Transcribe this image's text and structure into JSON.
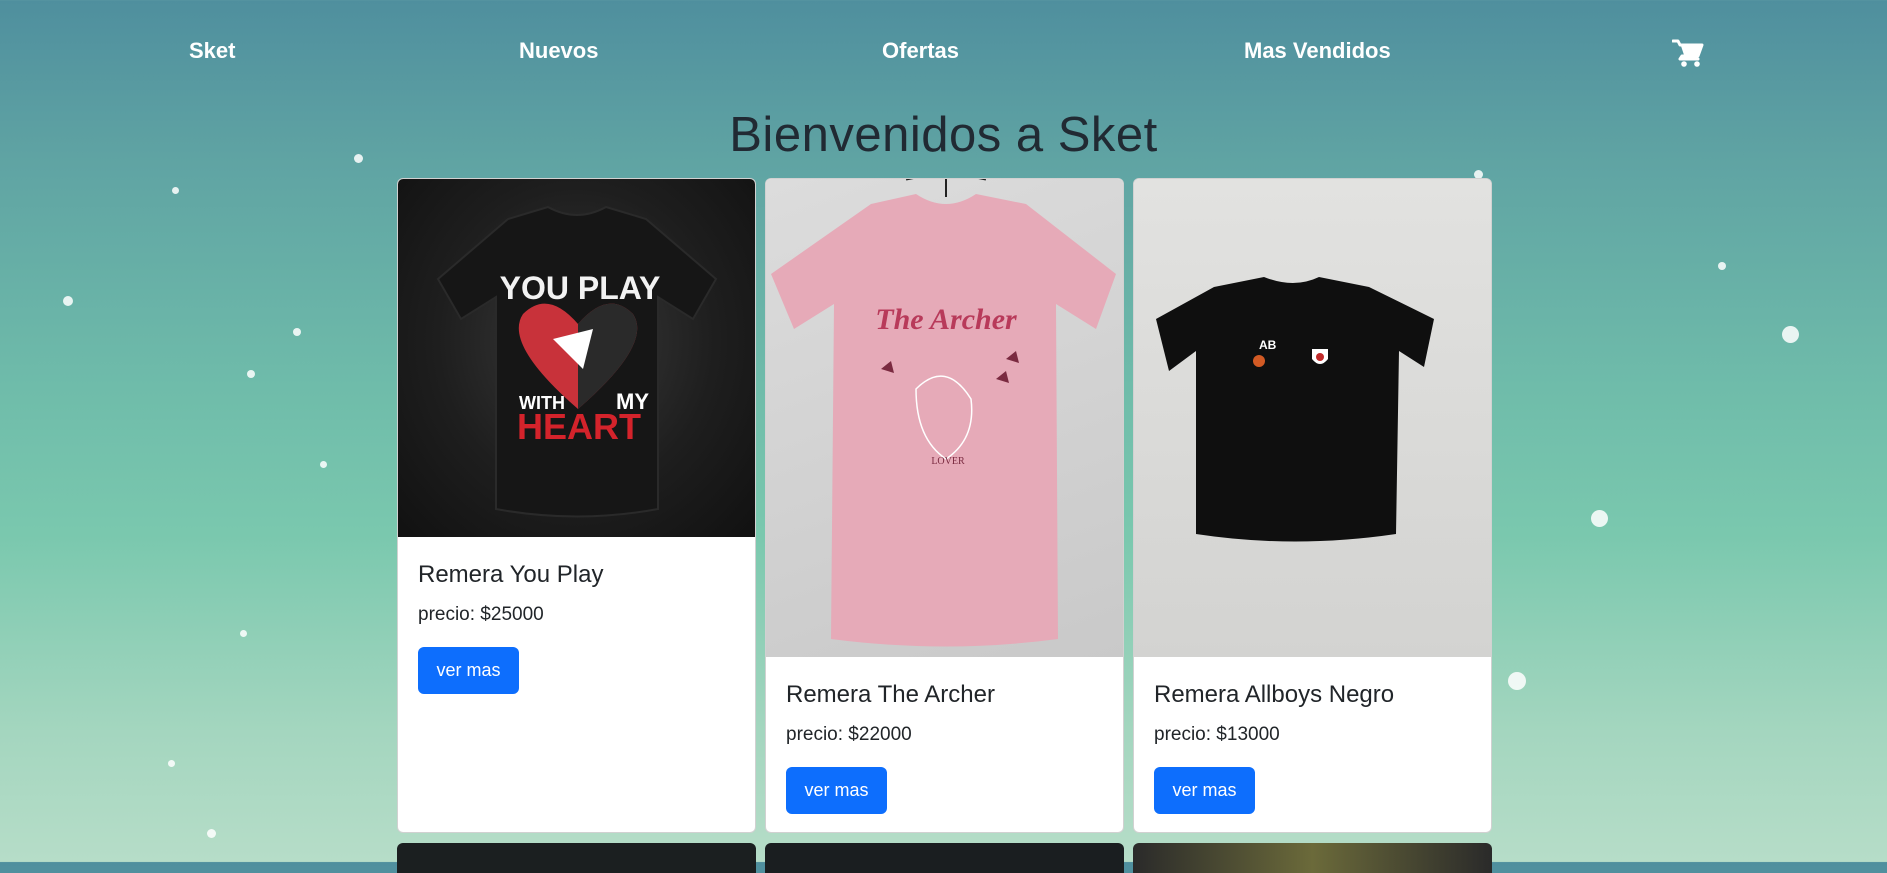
{
  "nav": {
    "brand": "Sket",
    "links": [
      "Nuevos",
      "Ofertas",
      "Mas Vendidos"
    ],
    "cart_icon": "shopping-cart-icon"
  },
  "page": {
    "heading": "Bienvenidos a Sket"
  },
  "products": [
    {
      "title": "Remera You Play",
      "price": "precio: $25000",
      "button": "ver mas",
      "shirt_color": "#1c1c1c",
      "print_text_top": "YOU PLAY",
      "print_text_mid": "WITH",
      "print_text_my": "MY",
      "print_text_bottom": "HEART"
    },
    {
      "title": "Remera The Archer",
      "price": "precio: $22000",
      "button": "ver mas",
      "shirt_color": "#e6aab8",
      "print_text_top": "The Archer",
      "print_text_bottom": "LOVER"
    },
    {
      "title": "Remera Allboys Negro",
      "price": "precio: $13000",
      "button": "ver mas",
      "shirt_color": "#0f0f0f",
      "print_text_top": "AB"
    }
  ],
  "colors": {
    "accent": "#0d6efd",
    "heading": "#212a33"
  }
}
